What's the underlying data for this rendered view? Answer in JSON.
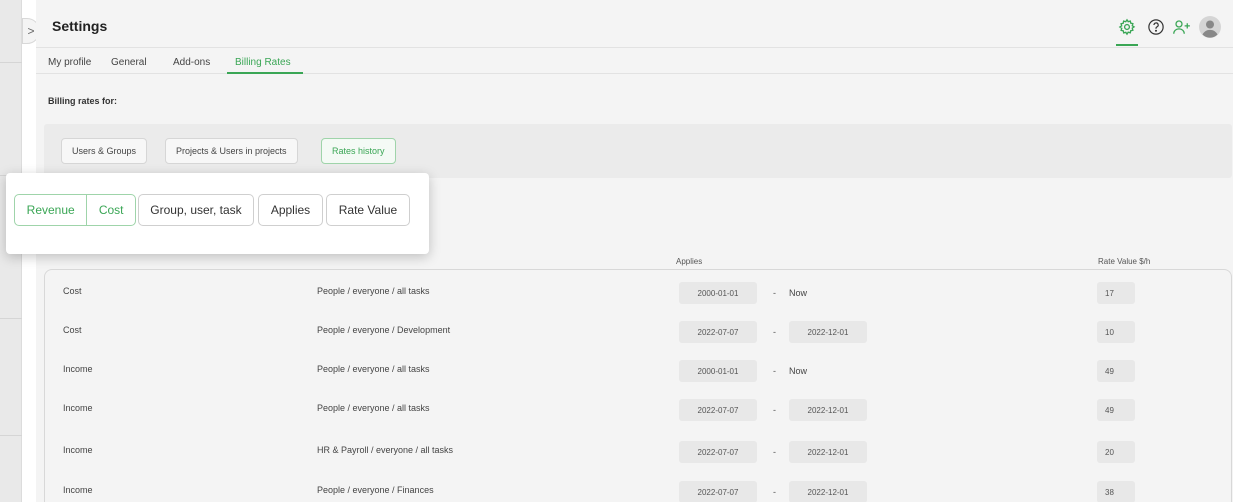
{
  "header": {
    "title": "Settings",
    "icons": [
      "gear-icon",
      "help-icon",
      "add-user-icon",
      "avatar-icon"
    ],
    "accent": "#3aa655"
  },
  "tabs": [
    {
      "label": "My profile",
      "active": false
    },
    {
      "label": "General",
      "active": false
    },
    {
      "label": "Add-ons",
      "active": false
    },
    {
      "label": "Billing Rates",
      "active": true
    }
  ],
  "section_label": "Billing rates for:",
  "panel_buttons": [
    {
      "label": "Users & Groups",
      "active": false
    },
    {
      "label": "Projects & Users in projects",
      "active": false
    },
    {
      "label": "Rates history",
      "active": true
    }
  ],
  "overlay": {
    "segment": [
      "Revenue",
      "Cost"
    ],
    "buttons": [
      "Group, user, task",
      "Applies",
      "Rate Value"
    ]
  },
  "columns": {
    "applies": "Applies",
    "rate": "Rate Value $/h"
  },
  "rows": [
    {
      "type": "Cost",
      "target": "People / everyone / all tasks",
      "from": "2000-01-01",
      "sep": "-",
      "to": "Now",
      "rate": "17"
    },
    {
      "type": "Cost",
      "target": "People / everyone / Development",
      "from": "2022-07-07",
      "sep": "-",
      "to": "2022-12-01",
      "rate": "10"
    },
    {
      "type": "Income",
      "target": "People / everyone / all tasks",
      "from": "2000-01-01",
      "sep": "-",
      "to": "Now",
      "rate": "49"
    },
    {
      "type": "Income",
      "target": "People / everyone / all tasks",
      "from": "2022-07-07",
      "sep": "-",
      "to": "2022-12-01",
      "rate": "49"
    },
    {
      "type": "Income",
      "target": "HR & Payroll / everyone / all tasks",
      "from": "2022-07-07",
      "sep": "-",
      "to": "2022-12-01",
      "rate": "20"
    },
    {
      "type": "Income",
      "target": "People / everyone / Finances",
      "from": "2022-07-07",
      "sep": "-",
      "to": "2022-12-01",
      "rate": "38"
    }
  ]
}
